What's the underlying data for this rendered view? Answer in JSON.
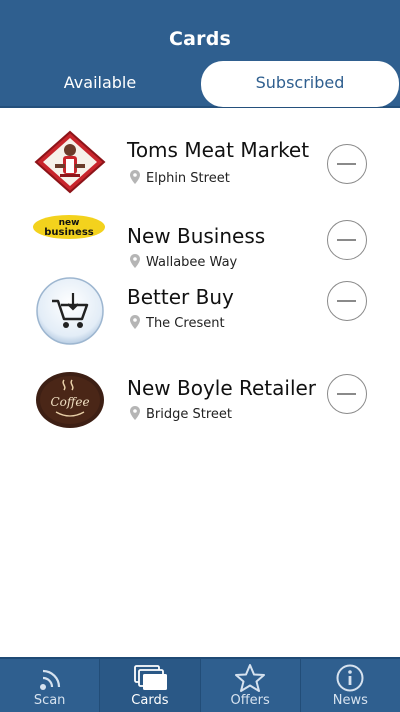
{
  "header": {
    "title": "Cards",
    "segments": [
      {
        "label": "Available",
        "selected": false
      },
      {
        "label": "Subscribed",
        "selected": true
      }
    ]
  },
  "cards": [
    {
      "name": "Toms Meat Market",
      "address": "Elphin Street",
      "logo_icon": "butcher-logo-icon",
      "logo_text": ""
    },
    {
      "name": "New Business",
      "address": "Wallabee Way",
      "logo_icon": "new-business-logo-icon",
      "logo_text": "new business"
    },
    {
      "name": "Better Buy",
      "address": "The Cresent",
      "logo_icon": "shopping-cart-logo-icon",
      "logo_text": ""
    },
    {
      "name": "New Boyle Retailer",
      "address": "Bridge Street",
      "logo_icon": "coffee-logo-icon",
      "logo_text": "Coffee"
    }
  ],
  "tabs": [
    {
      "label": "Scan",
      "icon": "scan-icon",
      "active": false
    },
    {
      "label": "Cards",
      "icon": "cards-icon",
      "active": true
    },
    {
      "label": "Offers",
      "icon": "star-icon",
      "active": false
    },
    {
      "label": "News",
      "icon": "info-icon",
      "active": false
    }
  ],
  "colors": {
    "header_bg": "#2f5f8f",
    "tabbar_bg": "#2f5f8f",
    "text_dark": "#111111",
    "remove_gray": "#8a8a8a"
  }
}
